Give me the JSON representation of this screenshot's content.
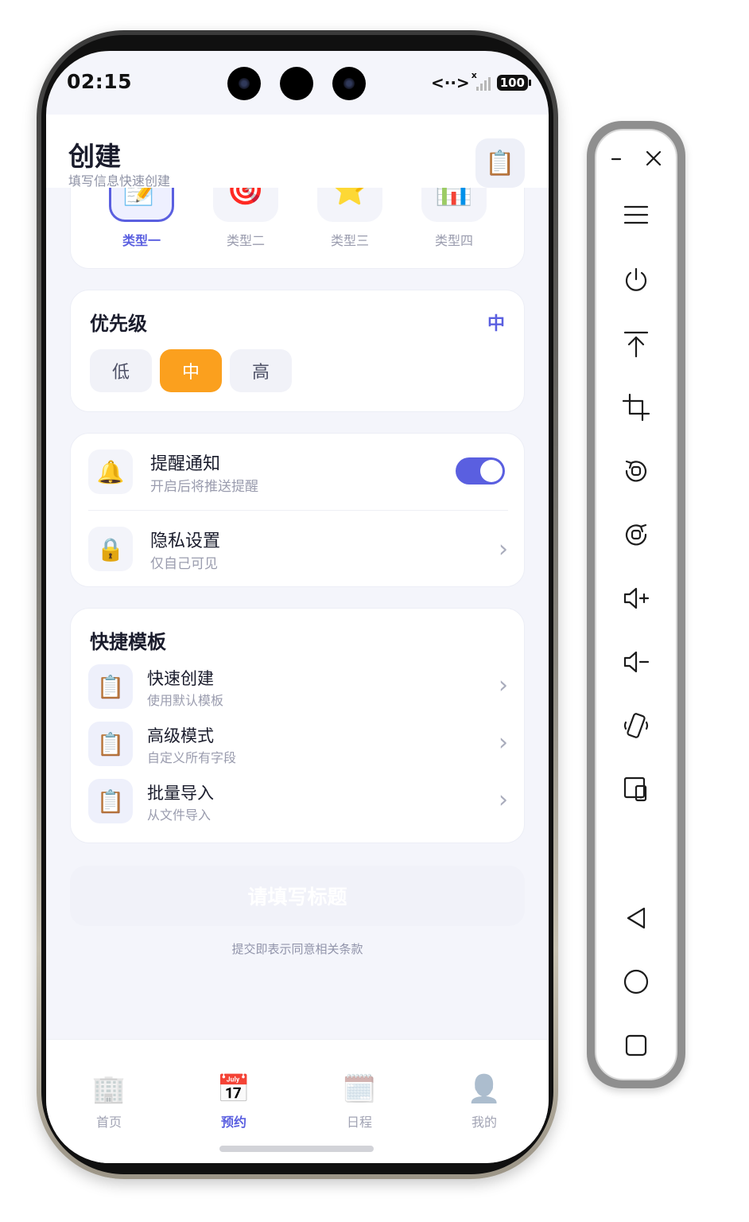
{
  "status_bar": {
    "time": "02:15",
    "network": "<··>",
    "signal_x": "x",
    "battery": "100"
  },
  "header": {
    "title": "创建",
    "subtitle": "填写信息快速创建",
    "action_icon": "clipboard-icon"
  },
  "types": [
    {
      "label": "类型一",
      "icon": "📝",
      "active": true
    },
    {
      "label": "类型二",
      "icon": "🎯",
      "active": false
    },
    {
      "label": "类型三",
      "icon": "⭐",
      "active": false
    },
    {
      "label": "类型四",
      "icon": "📊",
      "active": false
    }
  ],
  "priority": {
    "title": "优先级",
    "current": "中",
    "options": [
      {
        "label": "低",
        "active": false
      },
      {
        "label": "中",
        "active": true
      },
      {
        "label": "高",
        "active": false
      }
    ]
  },
  "settings": {
    "reminder": {
      "icon": "🔔",
      "title": "提醒通知",
      "subtitle": "开启后将推送提醒",
      "enabled": true
    },
    "privacy": {
      "icon": "🔒",
      "title": "隐私设置",
      "subtitle": "仅自己可见"
    }
  },
  "templates": {
    "title": "快捷模板",
    "items": [
      {
        "icon": "📋",
        "title": "快速创建",
        "subtitle": "使用默认模板"
      },
      {
        "icon": "📋",
        "title": "高级模式",
        "subtitle": "自定义所有字段"
      },
      {
        "icon": "📋",
        "title": "批量导入",
        "subtitle": "从文件导入"
      }
    ]
  },
  "submit": {
    "label": "请填写标题",
    "terms": "提交即表示同意相关条款"
  },
  "tabbar": [
    {
      "label": "首页",
      "icon": "🏢",
      "active": false
    },
    {
      "label": "预约",
      "icon": "📅",
      "active": true
    },
    {
      "label": "日程",
      "icon": "🗓️",
      "active": false
    },
    {
      "label": "我的",
      "icon": "👤",
      "active": false
    }
  ],
  "emulator_toolbar": {
    "buttons": [
      "minimize-icon",
      "close-icon",
      "menu-icon",
      "power-icon",
      "upload-icon",
      "crop-icon",
      "rotate-left-icon",
      "rotate-right-icon",
      "volume-up-icon",
      "volume-down-icon",
      "shake-icon",
      "multi-device-icon",
      "back-icon",
      "home-icon",
      "recents-icon"
    ]
  },
  "colors": {
    "accent": "#5a5fe0",
    "priority_active": "#fba01e",
    "background": "#f4f5fb"
  }
}
